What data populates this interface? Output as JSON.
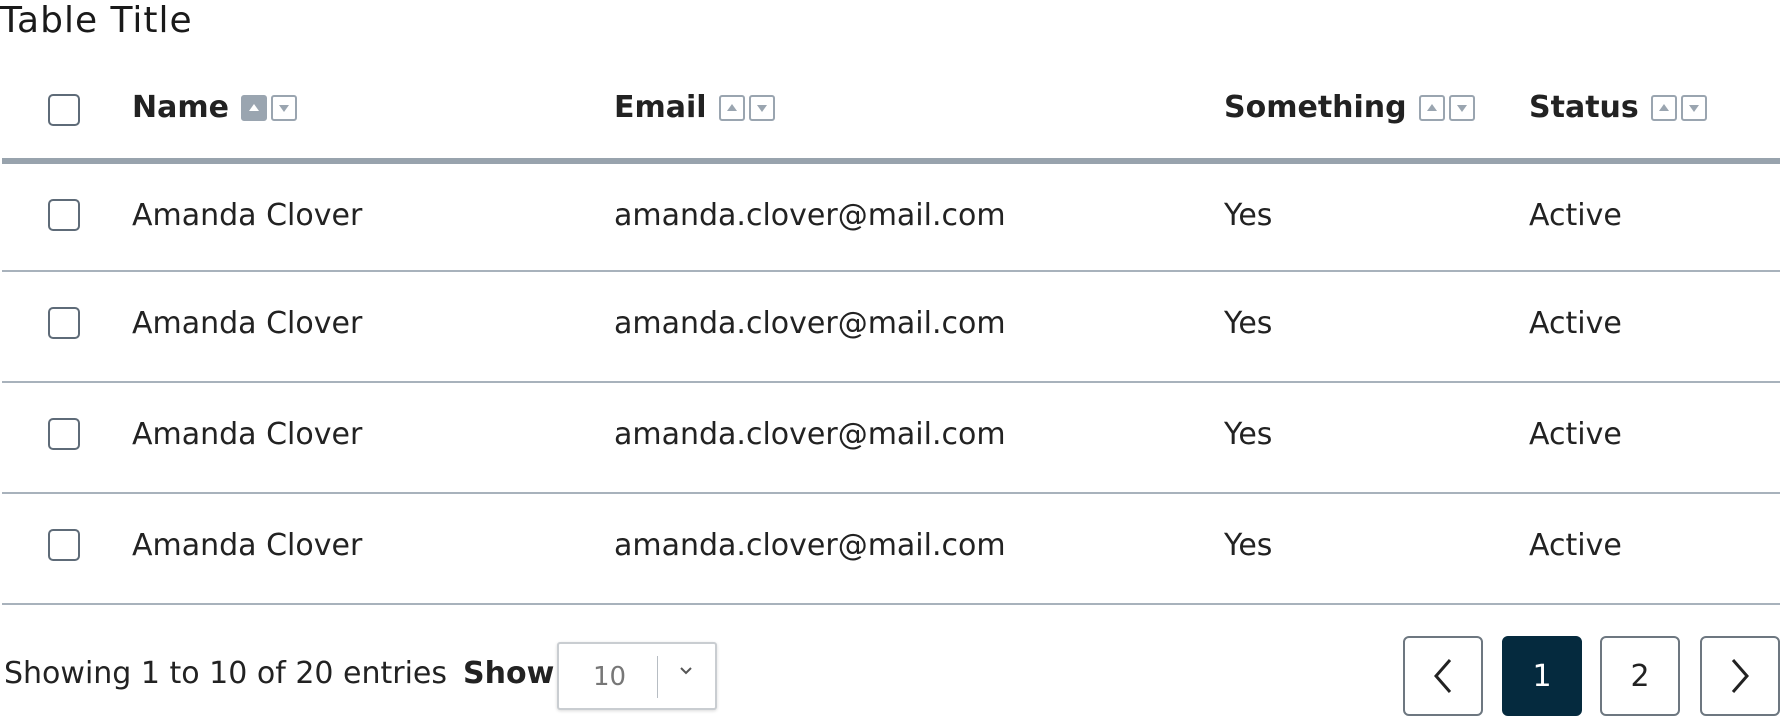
{
  "title": "Table Title",
  "columns": {
    "name": "Name",
    "email": "Email",
    "something": "Something",
    "status": "Status"
  },
  "rows": [
    {
      "name": "Amanda Clover",
      "email": "amanda.clover@mail.com",
      "something": "Yes",
      "status": "Active"
    },
    {
      "name": "Amanda Clover",
      "email": "amanda.clover@mail.com",
      "something": "Yes",
      "status": "Active"
    },
    {
      "name": "Amanda Clover",
      "email": "amanda.clover@mail.com",
      "something": "Yes",
      "status": "Active"
    },
    {
      "name": "Amanda Clover",
      "email": "amanda.clover@mail.com",
      "something": "Yes",
      "status": "Active"
    }
  ],
  "footer": {
    "showing": "Showing 1 to 10 of 20 entries",
    "show_label": "Show",
    "page_size": "10",
    "pages": [
      "1",
      "2"
    ],
    "current_page": "1"
  },
  "colors": {
    "accent": "#052a3e",
    "border": "#98a3ad"
  },
  "icons": {
    "sort_up": "sort-ascending-icon",
    "sort_down": "sort-descending-icon",
    "prev": "chevron-left-icon",
    "next": "chevron-right-icon",
    "dropdown": "chevron-down-icon"
  }
}
